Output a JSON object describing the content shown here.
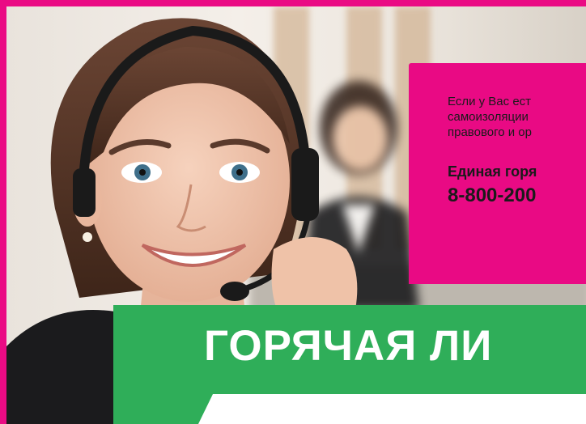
{
  "info": {
    "line1": "Если у Вас ест",
    "line2": "самоизоляции",
    "line3": "правового и ор",
    "hotline_label": "Единая горя",
    "phone": "8-800-200"
  },
  "title": "ГОРЯЧАЯ ЛИ",
  "colors": {
    "frame": "#ea0b84",
    "info_box": "#e90a84",
    "title_band": "#2fae59",
    "title_text": "#ffffff"
  },
  "image": {
    "subject": "operator-with-headset"
  }
}
